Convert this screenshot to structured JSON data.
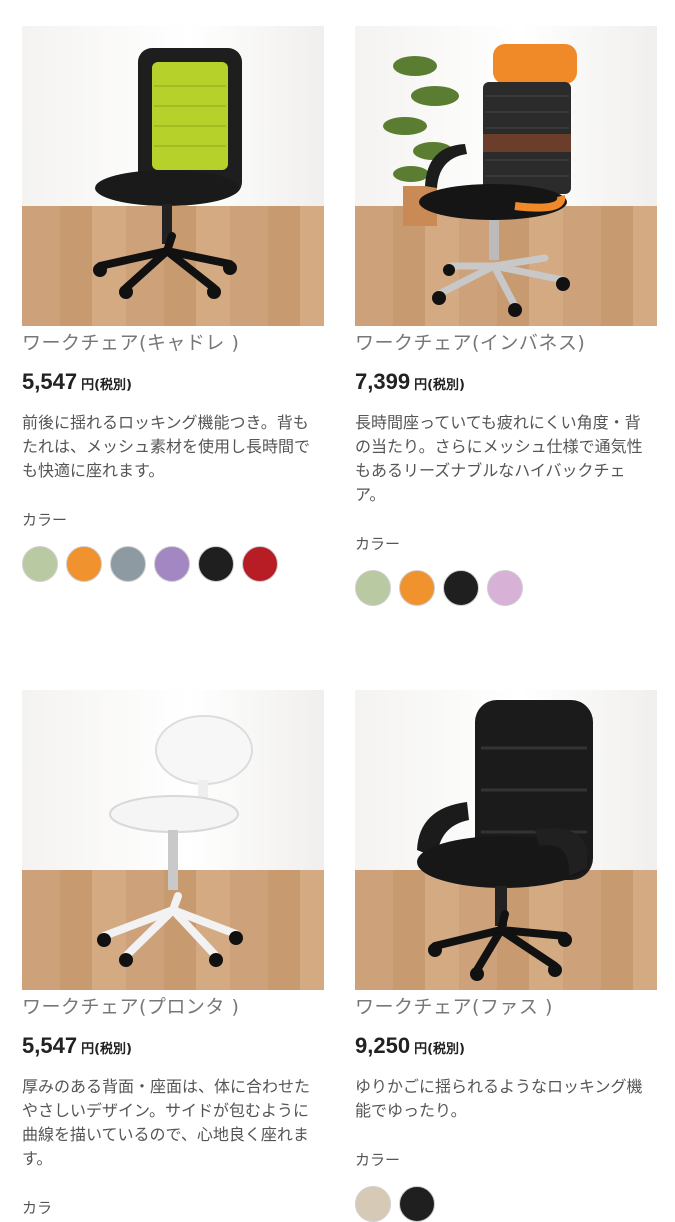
{
  "products": [
    {
      "name": "ワークチェア(キャドレ )",
      "price": "5,547",
      "unit": "円(税別)",
      "description": "前後に揺れるロッキング機能つき。背もたれは、メッシュ素材を使用し長時間でも快適に座れます。",
      "color_label": "カラー",
      "colors": [
        "#b9c9a1",
        "#f0922e",
        "#8e9aa1",
        "#a387c3",
        "#1f1f1f",
        "#b81c24"
      ]
    },
    {
      "name": "ワークチェア(インバネス)",
      "price": "7,399",
      "unit": "円(税別)",
      "description": "長時間座っていても疲れにくい角度・背の当たり。さらにメッシュ仕様で通気性もあるリーズナブルなハイバックチェア。",
      "color_label": "カラー",
      "colors": [
        "#b9c9a1",
        "#f0922e",
        "#1f1f1f",
        "#d7b1d6"
      ]
    },
    {
      "name": "ワークチェア(プロンタ )",
      "price": "5,547",
      "unit": "円(税別)",
      "description": "厚みのある背面・座面は、体に合わせたやさしいデザイン。サイドが包むように曲線を描いているので、心地良く座れます。",
      "color_label": "カラ",
      "colors": []
    },
    {
      "name": "ワークチェア(ファス )",
      "price": "9,250",
      "unit": "円(税別)",
      "description": "ゆりかごに揺られるようなロッキング機能でゆったり。",
      "color_label": "カラー",
      "colors": [
        "#d6c9b6",
        "#1f1f1f"
      ]
    }
  ]
}
